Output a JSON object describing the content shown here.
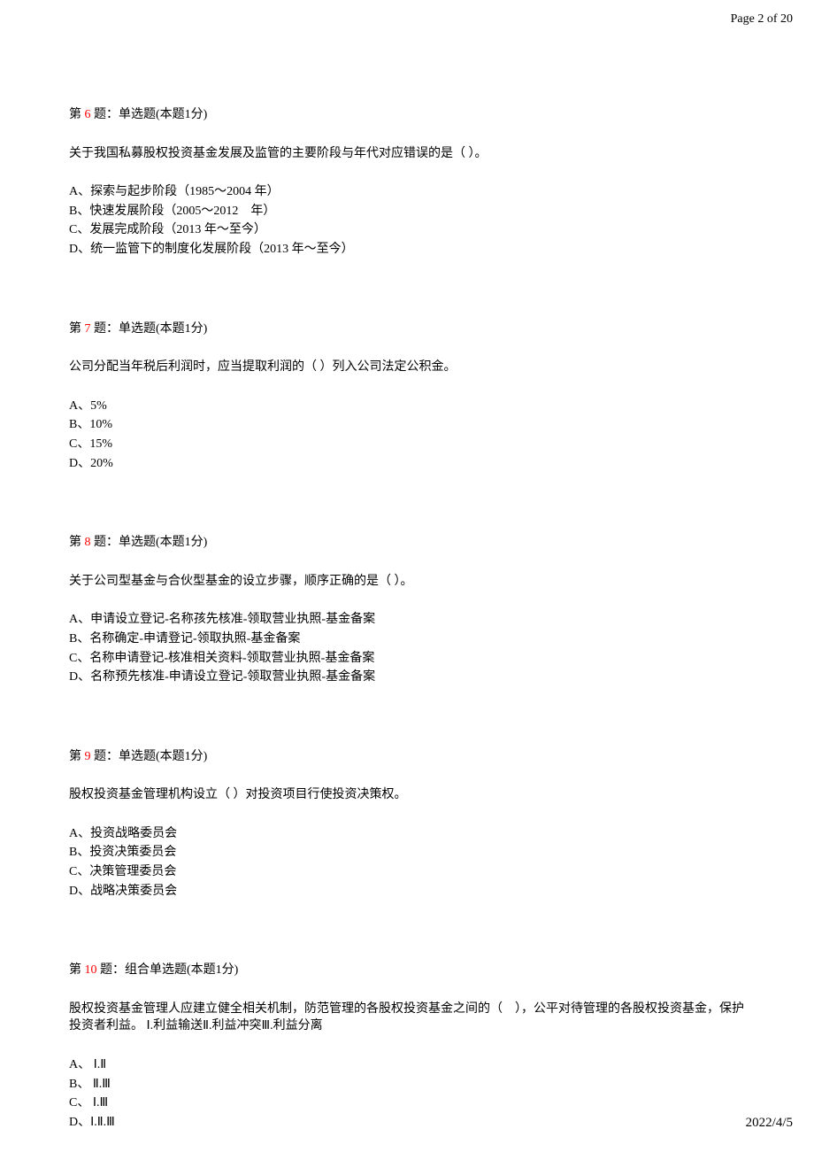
{
  "header": {
    "page_info": "Page 2 of 20"
  },
  "footer": {
    "date": "2022/4/5"
  },
  "questions": [
    {
      "prefix": "第 ",
      "number": "6",
      "suffix": " 题：单选题(本题1分)",
      "stem": "关于我国私募股权投资基金发展及监管的主要阶段与年代对应错误的是（ ）。",
      "options": [
        "A、探索与起步阶段（1985～2004 年）",
        "B、快速发展阶段（2005～2012　年）",
        "C、发展完成阶段（2013 年～至今）",
        "D、统一监管下的制度化发展阶段（2013 年～至今）"
      ]
    },
    {
      "prefix": "第 ",
      "number": "7",
      "suffix": " 题：单选题(本题1分)",
      "stem": "公司分配当年税后利润时，应当提取利润的（ ）列入公司法定公积金。",
      "options": [
        "A、5%",
        "B、10%",
        "C、15%",
        "D、20%"
      ]
    },
    {
      "prefix": "第 ",
      "number": "8",
      "suffix": " 题：单选题(本题1分)",
      "stem": "关于公司型基金与合伙型基金的设立步骤，顺序正确的是（ ）。",
      "options": [
        "A、申请设立登记-名称孩先核准-领取营业执照-基金备案",
        "B、名称确定-申请登记-领取执照-基金备案",
        "C、名称申请登记-核准相关资料-领取营业执照-基金备案",
        "D、名称预先核准-申请设立登记-领取营业执照-基金备案"
      ]
    },
    {
      "prefix": "第 ",
      "number": "9",
      "suffix": " 题：单选题(本题1分)",
      "stem": "股权投资基金管理机构设立（ ）对投资项目行使投资决策权。",
      "options": [
        "A、投资战略委员会",
        "B、投资决策委员会",
        "C、决策管理委员会",
        "D、战略决策委员会"
      ]
    },
    {
      "prefix": "第 ",
      "number": "10",
      "suffix": " 题：组合单选题(本题1分)",
      "stem": "股权投资基金管理人应建立健全相关机制，防范管理的各股权投资基金之间的（　），公平对待管理的各股权投资基金，保护投资者利益。 Ⅰ.利益输送Ⅱ.利益冲突Ⅲ.利益分离",
      "options": [
        "A、 Ⅰ.Ⅱ",
        "B、 Ⅱ.Ⅲ",
        "C、 Ⅰ.Ⅲ",
        "D、Ⅰ.Ⅱ.Ⅲ"
      ]
    }
  ]
}
